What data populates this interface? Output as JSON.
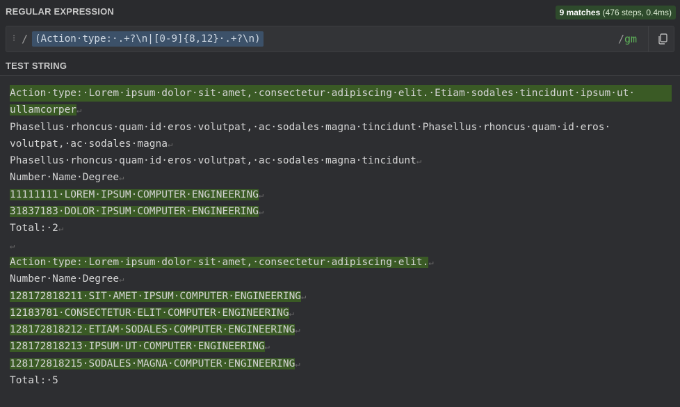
{
  "regex_section": {
    "label": "REGULAR EXPRESSION",
    "expression": "(Action·type:·.+?\\n|[0-9]{8,12}·.+?\\n)",
    "delimiter_open": "/",
    "delimiter_close": "/",
    "flags": "gm",
    "icons": [
      "drag-handle-icon",
      "copy-icon"
    ]
  },
  "match_info": {
    "count": "9 matches",
    "details": "(476 steps, 0.4ms)"
  },
  "test_section": {
    "label": "TEST STRING",
    "lines": [
      {
        "text": "Action·type:·Lorem·ipsum·dolor·sit·amet,·consectetur·adipiscing·elit.·Etiam·sodales·tincidunt·ipsum·ut·",
        "hl": "full"
      },
      {
        "text": "ullamcorper",
        "hl": "span",
        "ret": true
      },
      {
        "text": "Phasellus·rhoncus·quam·id·eros·volutpat,·ac·sodales·magna·tincidunt·Phasellus·rhoncus·quam·id·eros·",
        "hl": "none"
      },
      {
        "text": "volutpat,·ac·sodales·magna",
        "hl": "none",
        "ret": true
      },
      {
        "text": "Phasellus·rhoncus·quam·id·eros·volutpat,·ac·sodales·magna·tincidunt",
        "hl": "none",
        "ret": true
      },
      {
        "text": "Number·Name·Degree",
        "hl": "none",
        "ret": true
      },
      {
        "text": "11111111·LOREM·IPSUM·COMPUTER·ENGINEERING",
        "hl": "span",
        "ret": true
      },
      {
        "text": "31837183·DOLOR·IPSUM·COMPUTER·ENGINEERING",
        "hl": "span",
        "ret": true
      },
      {
        "text": "Total:·2",
        "hl": "none",
        "ret": true
      },
      {
        "text": "",
        "hl": "none",
        "ret": true
      },
      {
        "text": "Action·type:·Lorem·ipsum·dolor·sit·amet,·consectetur·adipiscing·elit.",
        "hl": "span",
        "ret": true
      },
      {
        "text": "Number·Name·Degree",
        "hl": "none",
        "ret": true
      },
      {
        "text": "128172818211·SIT·AMET·IPSUM·COMPUTER·ENGINEERING",
        "hl": "span",
        "ret": true
      },
      {
        "text": "12183781·CONSECTETUR·ELIT·COMPUTER·ENGINEERING",
        "hl": "span",
        "ret": true
      },
      {
        "text": "128172818212·ETIAM·SODALES·COMPUTER·ENGINEERING",
        "hl": "span",
        "ret": true
      },
      {
        "text": "128172818213·IPSUM·UT·COMPUTER·ENGINEERING",
        "hl": "span",
        "ret": true
      },
      {
        "text": "128172818215·SODALES·MAGNA·COMPUTER·ENGINEERING",
        "hl": "span",
        "ret": true
      },
      {
        "text": "Total:·5",
        "hl": "none",
        "ret": false
      }
    ]
  },
  "colors": {
    "background": "#2a2b2e",
    "match_highlight": "#3a5a25",
    "regex_highlight": "#3c5169",
    "flags": "#5fb45a"
  }
}
